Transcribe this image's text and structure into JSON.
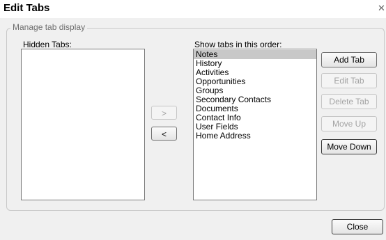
{
  "window": {
    "title": "Edit Tabs",
    "close_glyph": "✕"
  },
  "group": {
    "label": "Manage tab display"
  },
  "hidden_tabs": {
    "label": "Hidden Tabs:",
    "items": []
  },
  "shown_tabs": {
    "label": "Show tabs in this order:",
    "selected_index": 0,
    "items": [
      "Notes",
      "History",
      "Activities",
      "Opportunities",
      "Groups",
      "Secondary Contacts",
      "Documents",
      "Contact Info",
      "User Fields",
      "Home Address"
    ]
  },
  "move_buttons": {
    "right": ">",
    "left": "<",
    "right_enabled": false,
    "left_enabled": true
  },
  "actions": {
    "add_tab": "Add Tab",
    "edit_tab": "Edit Tab",
    "delete_tab": "Delete Tab",
    "move_up": "Move Up",
    "move_down": "Move Down",
    "close": "Close",
    "add_enabled": true,
    "edit_enabled": false,
    "delete_enabled": false,
    "move_up_enabled": false,
    "move_down_enabled": true
  }
}
